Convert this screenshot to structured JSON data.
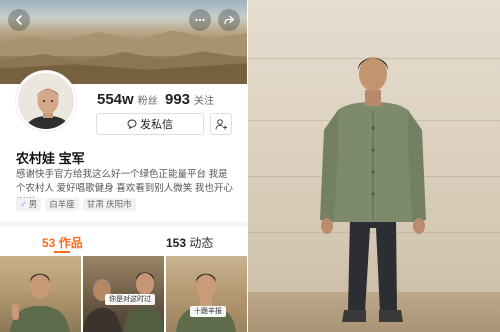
{
  "profile": {
    "fans_count": "554w",
    "fans_label": "粉丝",
    "following_count": "993",
    "following_label": "关注",
    "message_button": "发私信",
    "name": "农村娃 宝军",
    "bio": "感谢快手官方给我这么好一个绿色正能量平台 我是个农村人 爱好唱歌健身 喜欢看到别人微笑 我也开心 谢谢",
    "tags": {
      "gender": "男",
      "zodiac": "白羊座",
      "location": "甘肃 庆阳市"
    }
  },
  "tabs": {
    "works_count": "53",
    "works_label": "作品",
    "dynamics_count": "153",
    "dynamics_label": "动态"
  },
  "thumbnails": [
    {
      "caption": ""
    },
    {
      "caption": "你是对这时过"
    },
    {
      "caption": "十跪羊报"
    }
  ],
  "icons": {
    "back": "back-arrow-icon",
    "more": "more-dots-icon",
    "share": "share-icon",
    "message": "chat-bubble-icon",
    "add_friend": "add-user-icon",
    "gender": "male-icon"
  },
  "colors": {
    "accent": "#ff6a1a",
    "male": "#3d8df5"
  }
}
